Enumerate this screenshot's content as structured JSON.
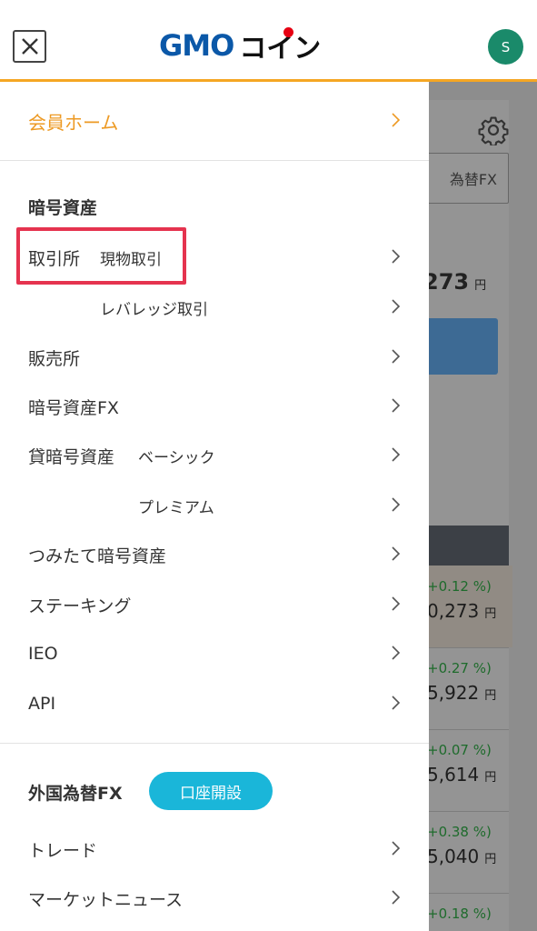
{
  "header": {
    "logo_gmo": "GMO",
    "logo_coin": "コイン",
    "avatar_initial": "S"
  },
  "menu": {
    "home": "会員ホーム",
    "crypto_section": "暗号資産",
    "exchange": "取引所",
    "spot": "現物取引",
    "leverage": "レバレッジ取引",
    "sales": "販売所",
    "crypto_fx": "暗号資産FX",
    "lending": "貸暗号資産",
    "basic": "ベーシック",
    "premium": "プレミアム",
    "tsumitate": "つみたて暗号資産",
    "staking": "ステーキング",
    "ieo": "IEO",
    "api": "API",
    "forex_section": "外国為替FX",
    "open_account": "口座開設",
    "trade": "トレード",
    "market_news": "マーケットニュース"
  },
  "background": {
    "tab_label": "為替FX",
    "price_main": "273",
    "price_unit": "円",
    "rows": [
      {
        "change": "+0.12 %)",
        "value": "0,273"
      },
      {
        "change": "+0.27 %)",
        "value": "5,922"
      },
      {
        "change": "+0.07 %)",
        "value": "5,614"
      },
      {
        "change": "+0.38 %)",
        "value": "5,040"
      },
      {
        "change": "+0.18 %)",
        "value": ""
      }
    ]
  }
}
